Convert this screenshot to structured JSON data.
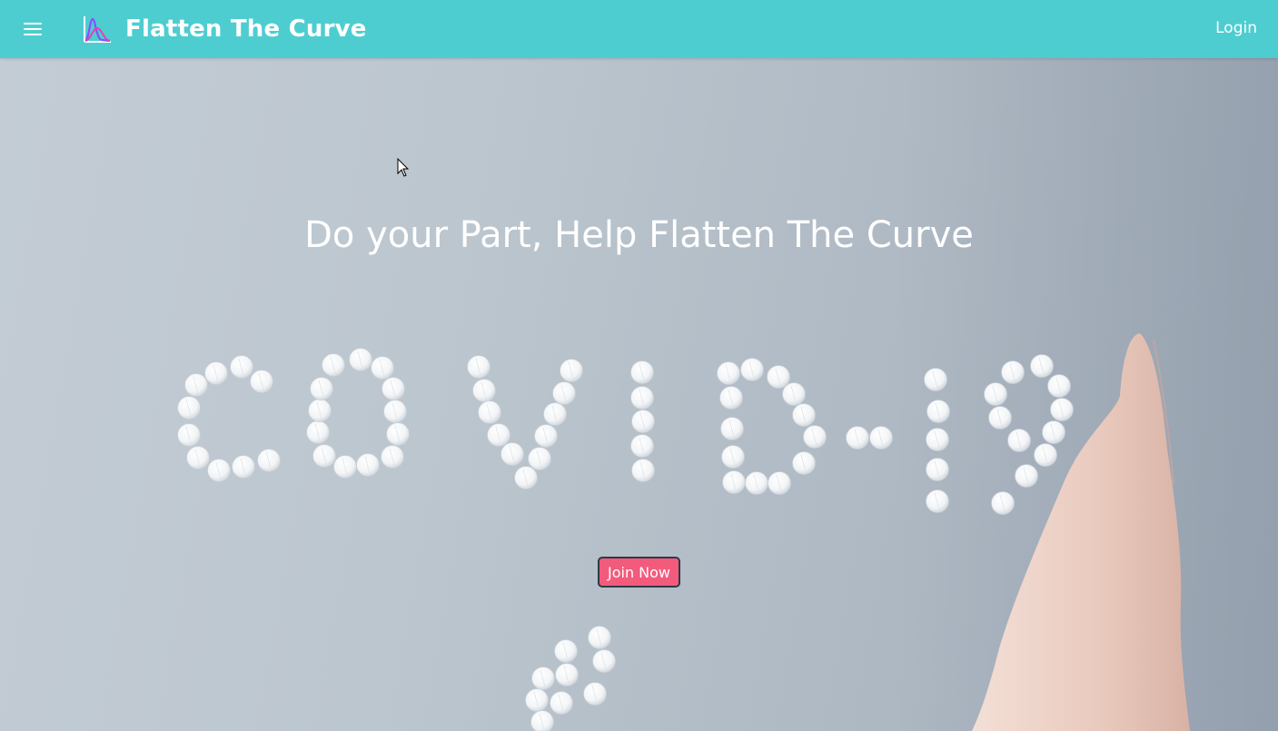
{
  "navbar": {
    "menu_icon": "hamburger-menu-icon",
    "brand_logo_icon": "curve-chart-logo-icon",
    "brand_title": "Flatten The Curve",
    "login_label": "Login",
    "background_color": "#4ecdd0"
  },
  "hero": {
    "headline": "Do your Part, Help Flatten The Curve",
    "background_image": "pills spelling COVID-19 with hand",
    "join_button_label": "Join Now",
    "join_button_color": "#f35b7c"
  }
}
